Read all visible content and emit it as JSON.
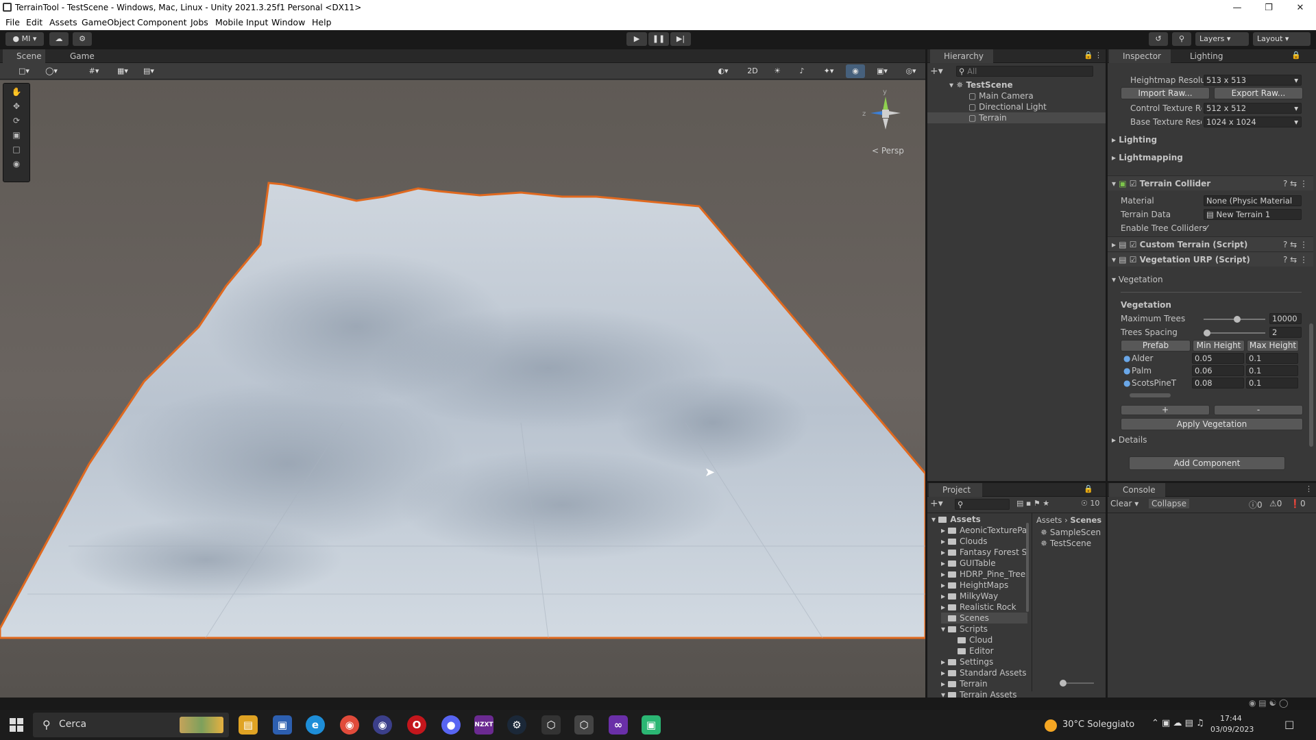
{
  "window": {
    "title": "TerrainTool - TestScene - Windows, Mac, Linux - Unity 2021.3.25f1 Personal <DX11>"
  },
  "menu": [
    "File",
    "Edit",
    "Assets",
    "GameObject",
    "Component",
    "Jobs",
    "Mobile Input",
    "Window",
    "Help"
  ],
  "toolbar": {
    "account": "MI",
    "layers": "Layers",
    "layout": "Layout"
  },
  "scene": {
    "tab_scene": "Scene",
    "tab_game": "Game",
    "mode_2d": "2D",
    "persp": "< Persp",
    "gizmo_y": "y",
    "gizmo_z": "z"
  },
  "hierarchy": {
    "tab": "Hierarchy",
    "search": "All",
    "scene": "TestScene",
    "items": [
      "Main Camera",
      "Directional Light",
      "Terrain"
    ]
  },
  "inspector": {
    "tab_inspector": "Inspector",
    "tab_lighting": "Lighting",
    "heightmap_label": "Heightmap Resolut",
    "heightmap_value": "513 x 513",
    "import_raw": "Import Raw...",
    "export_raw": "Export Raw...",
    "control_label": "Control Texture Re",
    "control_value": "512 x 512",
    "base_label": "Base Texture Reso",
    "base_value": "1024 x 1024",
    "lighting": "Lighting",
    "lightmapping": "Lightmapping",
    "collider": {
      "title": "Terrain Collider",
      "material_label": "Material",
      "material_value": "None (Physic Material",
      "data_label": "Terrain Data",
      "data_value": "New Terrain 1",
      "enable_trees": "Enable Tree Colliders"
    },
    "custom_terrain": "Custom Terrain (Script)",
    "veg_script": "Vegetation URP (Script)",
    "veg_foldout": "Vegetation",
    "veg_header": "Vegetation",
    "max_trees_label": "Maximum Trees",
    "max_trees_value": "10000",
    "max_trees_level": 0.55,
    "spacing_label": "Trees Spacing",
    "spacing_value": "2",
    "spacing_level": 0.0,
    "columns": [
      "Prefab",
      "Min Height",
      "Max Height"
    ],
    "rows": [
      {
        "name": "Alder",
        "min": "0.05",
        "max": "0.1"
      },
      {
        "name": "Palm",
        "min": "0.06",
        "max": "0.1"
      },
      {
        "name": "ScotsPineT",
        "min": "0.08",
        "max": "0.1"
      }
    ],
    "add_btn": "+",
    "remove_btn": "-",
    "apply_btn": "Apply Vegetation",
    "details": "Details",
    "add_component": "Add Component"
  },
  "project": {
    "tab": "Project",
    "count": "10",
    "breadcrumb_root": "Assets",
    "breadcrumb_leaf": "Scenes",
    "tree_root": "Assets",
    "folders": [
      "AeonicTexturePa",
      "Clouds",
      "Fantasy Forest S",
      "GUITable",
      "HDRP_Pine_Tree",
      "HeightMaps",
      "MilkyWay",
      "Realistic Rock",
      "Scenes",
      "Scripts",
      "Cloud",
      "Editor",
      "Settings",
      "Standard Assets",
      "Terrain",
      "Terrain Assets"
    ],
    "files": [
      "SampleScen",
      "TestScene"
    ]
  },
  "console": {
    "tab": "Console",
    "clear": "Clear",
    "collapse": "Collapse",
    "logs": "0",
    "warnings": "0",
    "errors": "0"
  },
  "taskbar": {
    "search": "Cerca",
    "weather": "30°C Soleggiato",
    "time": "17:44",
    "date": "03/09/2023"
  }
}
